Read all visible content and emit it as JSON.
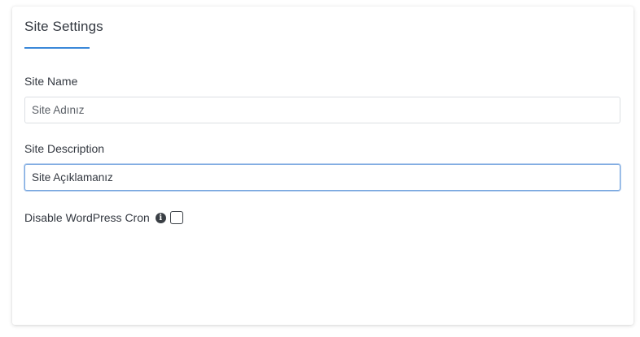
{
  "card": {
    "title": "Site Settings"
  },
  "fields": {
    "site_name": {
      "label": "Site Name",
      "value": "Site Adınız"
    },
    "site_description": {
      "label": "Site Description",
      "value": "Site Açıklamanız"
    }
  },
  "cron": {
    "label": "Disable WordPress Cron",
    "info_icon": "info-icon",
    "info_glyph": "i",
    "checked": false
  },
  "colors": {
    "accent": "#3b88d9",
    "text": "#333840",
    "input_border": "#dcdfe3",
    "focus_border": "#7aa8e0"
  }
}
